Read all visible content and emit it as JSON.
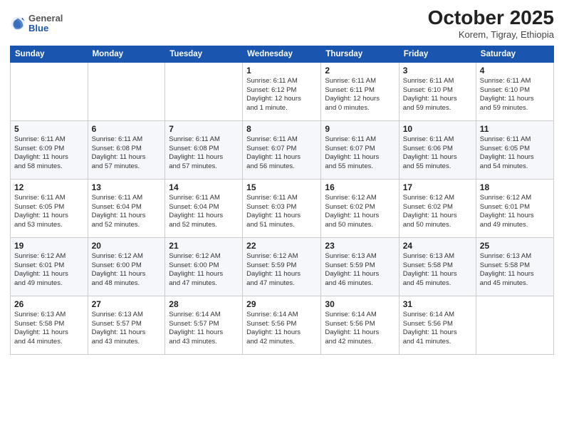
{
  "header": {
    "logo_general": "General",
    "logo_blue": "Blue",
    "month_title": "October 2025",
    "subtitle": "Korem, Tigray, Ethiopia"
  },
  "weekdays": [
    "Sunday",
    "Monday",
    "Tuesday",
    "Wednesday",
    "Thursday",
    "Friday",
    "Saturday"
  ],
  "weeks": [
    [
      {
        "day": "",
        "info": ""
      },
      {
        "day": "",
        "info": ""
      },
      {
        "day": "",
        "info": ""
      },
      {
        "day": "1",
        "info": "Sunrise: 6:11 AM\nSunset: 6:12 PM\nDaylight: 12 hours\nand 1 minute."
      },
      {
        "day": "2",
        "info": "Sunrise: 6:11 AM\nSunset: 6:11 PM\nDaylight: 12 hours\nand 0 minutes."
      },
      {
        "day": "3",
        "info": "Sunrise: 6:11 AM\nSunset: 6:10 PM\nDaylight: 11 hours\nand 59 minutes."
      },
      {
        "day": "4",
        "info": "Sunrise: 6:11 AM\nSunset: 6:10 PM\nDaylight: 11 hours\nand 59 minutes."
      }
    ],
    [
      {
        "day": "5",
        "info": "Sunrise: 6:11 AM\nSunset: 6:09 PM\nDaylight: 11 hours\nand 58 minutes."
      },
      {
        "day": "6",
        "info": "Sunrise: 6:11 AM\nSunset: 6:08 PM\nDaylight: 11 hours\nand 57 minutes."
      },
      {
        "day": "7",
        "info": "Sunrise: 6:11 AM\nSunset: 6:08 PM\nDaylight: 11 hours\nand 57 minutes."
      },
      {
        "day": "8",
        "info": "Sunrise: 6:11 AM\nSunset: 6:07 PM\nDaylight: 11 hours\nand 56 minutes."
      },
      {
        "day": "9",
        "info": "Sunrise: 6:11 AM\nSunset: 6:07 PM\nDaylight: 11 hours\nand 55 minutes."
      },
      {
        "day": "10",
        "info": "Sunrise: 6:11 AM\nSunset: 6:06 PM\nDaylight: 11 hours\nand 55 minutes."
      },
      {
        "day": "11",
        "info": "Sunrise: 6:11 AM\nSunset: 6:05 PM\nDaylight: 11 hours\nand 54 minutes."
      }
    ],
    [
      {
        "day": "12",
        "info": "Sunrise: 6:11 AM\nSunset: 6:05 PM\nDaylight: 11 hours\nand 53 minutes."
      },
      {
        "day": "13",
        "info": "Sunrise: 6:11 AM\nSunset: 6:04 PM\nDaylight: 11 hours\nand 52 minutes."
      },
      {
        "day": "14",
        "info": "Sunrise: 6:11 AM\nSunset: 6:04 PM\nDaylight: 11 hours\nand 52 minutes."
      },
      {
        "day": "15",
        "info": "Sunrise: 6:11 AM\nSunset: 6:03 PM\nDaylight: 11 hours\nand 51 minutes."
      },
      {
        "day": "16",
        "info": "Sunrise: 6:12 AM\nSunset: 6:02 PM\nDaylight: 11 hours\nand 50 minutes."
      },
      {
        "day": "17",
        "info": "Sunrise: 6:12 AM\nSunset: 6:02 PM\nDaylight: 11 hours\nand 50 minutes."
      },
      {
        "day": "18",
        "info": "Sunrise: 6:12 AM\nSunset: 6:01 PM\nDaylight: 11 hours\nand 49 minutes."
      }
    ],
    [
      {
        "day": "19",
        "info": "Sunrise: 6:12 AM\nSunset: 6:01 PM\nDaylight: 11 hours\nand 49 minutes."
      },
      {
        "day": "20",
        "info": "Sunrise: 6:12 AM\nSunset: 6:00 PM\nDaylight: 11 hours\nand 48 minutes."
      },
      {
        "day": "21",
        "info": "Sunrise: 6:12 AM\nSunset: 6:00 PM\nDaylight: 11 hours\nand 47 minutes."
      },
      {
        "day": "22",
        "info": "Sunrise: 6:12 AM\nSunset: 5:59 PM\nDaylight: 11 hours\nand 47 minutes."
      },
      {
        "day": "23",
        "info": "Sunrise: 6:13 AM\nSunset: 5:59 PM\nDaylight: 11 hours\nand 46 minutes."
      },
      {
        "day": "24",
        "info": "Sunrise: 6:13 AM\nSunset: 5:58 PM\nDaylight: 11 hours\nand 45 minutes."
      },
      {
        "day": "25",
        "info": "Sunrise: 6:13 AM\nSunset: 5:58 PM\nDaylight: 11 hours\nand 45 minutes."
      }
    ],
    [
      {
        "day": "26",
        "info": "Sunrise: 6:13 AM\nSunset: 5:58 PM\nDaylight: 11 hours\nand 44 minutes."
      },
      {
        "day": "27",
        "info": "Sunrise: 6:13 AM\nSunset: 5:57 PM\nDaylight: 11 hours\nand 43 minutes."
      },
      {
        "day": "28",
        "info": "Sunrise: 6:14 AM\nSunset: 5:57 PM\nDaylight: 11 hours\nand 43 minutes."
      },
      {
        "day": "29",
        "info": "Sunrise: 6:14 AM\nSunset: 5:56 PM\nDaylight: 11 hours\nand 42 minutes."
      },
      {
        "day": "30",
        "info": "Sunrise: 6:14 AM\nSunset: 5:56 PM\nDaylight: 11 hours\nand 42 minutes."
      },
      {
        "day": "31",
        "info": "Sunrise: 6:14 AM\nSunset: 5:56 PM\nDaylight: 11 hours\nand 41 minutes."
      },
      {
        "day": "",
        "info": ""
      }
    ]
  ]
}
